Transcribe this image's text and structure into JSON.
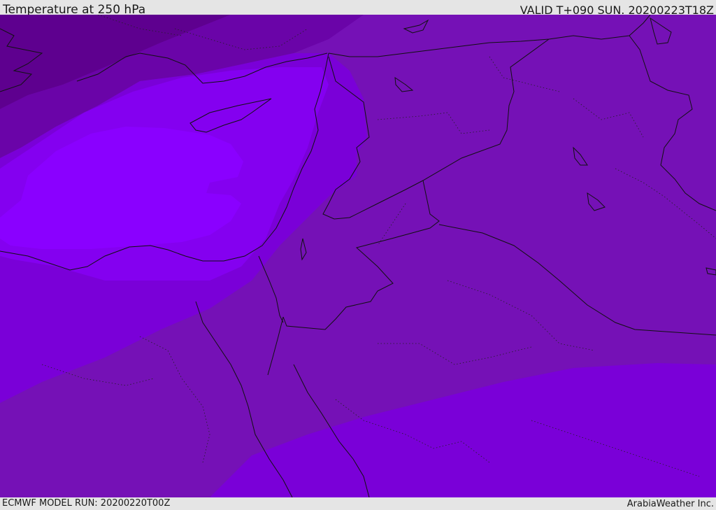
{
  "header": {
    "title": "Temperature at 250 hPa",
    "valid_time": "VALID T+090 SUN. 20200223T18Z"
  },
  "footer": {
    "model_run": "ECMWF MODEL RUN: 20200220T00Z",
    "brand": "ArabiaWeather Inc."
  },
  "palette": {
    "coldest": "#5e008f",
    "cold": "#6a04a8",
    "mid": "#7511b6",
    "warm": "#7a00d8",
    "warmer": "#8400f0",
    "warmest": "#8a00ff",
    "borders": "#111111"
  }
}
